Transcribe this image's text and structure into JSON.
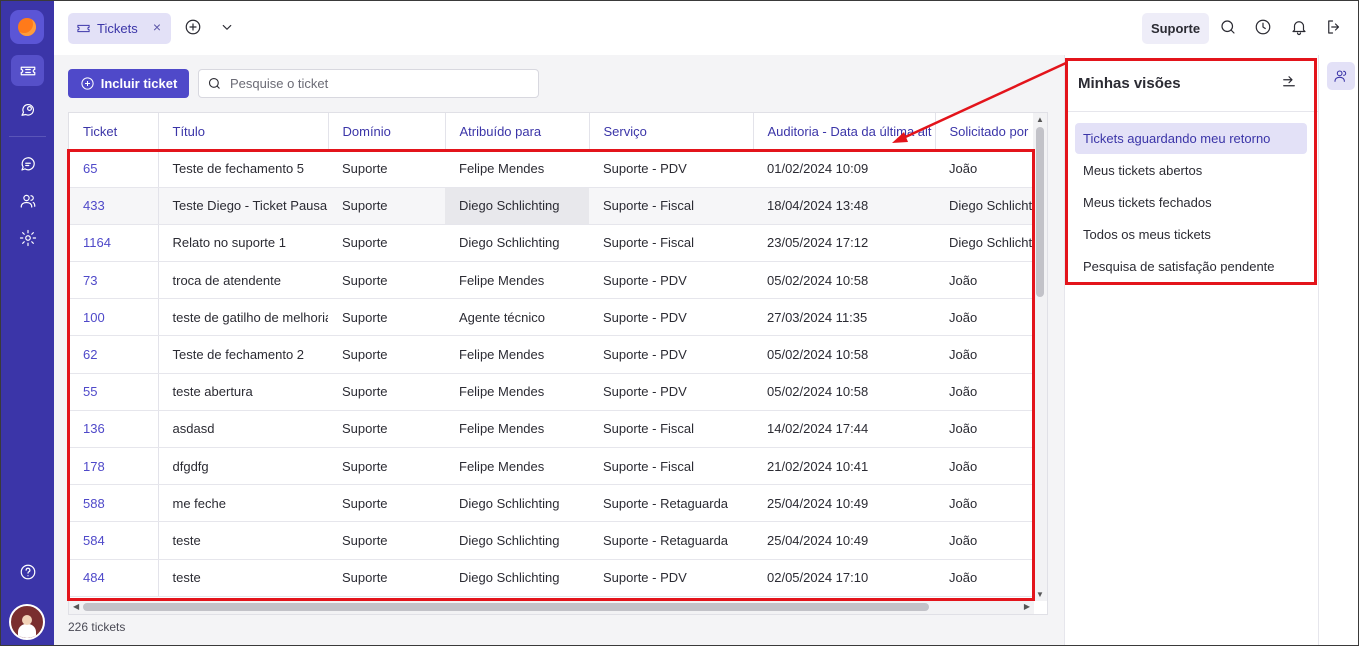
{
  "colors": {
    "sidebar": "#3b35a8",
    "accent": "#4f49c9",
    "annotation": "#e3141b"
  },
  "sidebar": {
    "items": [
      {
        "name": "ticket-icon",
        "active": true
      },
      {
        "name": "chat-search-icon",
        "active": false
      },
      {
        "name": "chat-icon",
        "active": false
      },
      {
        "name": "users-icon",
        "active": false
      },
      {
        "name": "gear-icon",
        "active": false
      },
      {
        "name": "help-icon",
        "active": false
      }
    ]
  },
  "topbar": {
    "tab_label": "Tickets",
    "tab_close": "×",
    "context_button": "Suporte"
  },
  "toolbar": {
    "include_label": "Incluir ticket",
    "search_placeholder": "Pesquise o ticket"
  },
  "table": {
    "columns": [
      "Ticket",
      "Título",
      "Domínio",
      "Atribuído para",
      "Serviço",
      "Auditoria - Data da última alt",
      "Solicitado por"
    ],
    "rows": [
      [
        "65",
        "Teste de fechamento 5",
        "Suporte",
        "Felipe Mendes",
        "Suporte - PDV",
        "01/02/2024 10:09",
        "João"
      ],
      [
        "433",
        "Teste Diego - Ticket Pausa",
        "Suporte",
        "Diego Schlichting",
        "Suporte - Fiscal",
        "18/04/2024 13:48",
        "Diego Schlichting"
      ],
      [
        "1164",
        "Relato no suporte 1",
        "Suporte",
        "Diego Schlichting",
        "Suporte - Fiscal",
        "23/05/2024 17:12",
        "Diego Schlichting"
      ],
      [
        "73",
        "troca de atendente",
        "Suporte",
        "Felipe Mendes",
        "Suporte - PDV",
        "05/02/2024 10:58",
        "João"
      ],
      [
        "100",
        "teste de gatilho de melhoria",
        "Suporte",
        "Agente técnico",
        "Suporte - PDV",
        "27/03/2024 11:35",
        "João"
      ],
      [
        "62",
        "Teste de fechamento 2",
        "Suporte",
        "Felipe Mendes",
        "Suporte - PDV",
        "05/02/2024 10:58",
        "João"
      ],
      [
        "55",
        "teste abertura",
        "Suporte",
        "Felipe Mendes",
        "Suporte - PDV",
        "05/02/2024 10:58",
        "João"
      ],
      [
        "136",
        "asdasd",
        "Suporte",
        "Felipe Mendes",
        "Suporte - Fiscal",
        "14/02/2024 17:44",
        "João"
      ],
      [
        "178",
        "dfgdfg",
        "Suporte",
        "Felipe Mendes",
        "Suporte - Fiscal",
        "21/02/2024 10:41",
        "João"
      ],
      [
        "588",
        "me feche",
        "Suporte",
        "Diego Schlichting",
        "Suporte - Retaguarda",
        "25/04/2024 10:49",
        "João"
      ],
      [
        "584",
        "teste",
        "Suporte",
        "Diego Schlichting",
        "Suporte - Retaguarda",
        "25/04/2024 10:49",
        "João"
      ],
      [
        "484",
        "teste",
        "Suporte",
        "Diego Schlichting",
        "Suporte - PDV",
        "02/05/2024 17:10",
        "João"
      ]
    ],
    "count_label": "226 tickets"
  },
  "views_panel": {
    "title": "Minhas visões",
    "items": [
      "Tickets aguardando meu retorno",
      "Meus tickets abertos",
      "Meus tickets fechados",
      "Todos os meus tickets",
      "Pesquisa de satisfação pendente"
    ],
    "active_index": 0
  }
}
